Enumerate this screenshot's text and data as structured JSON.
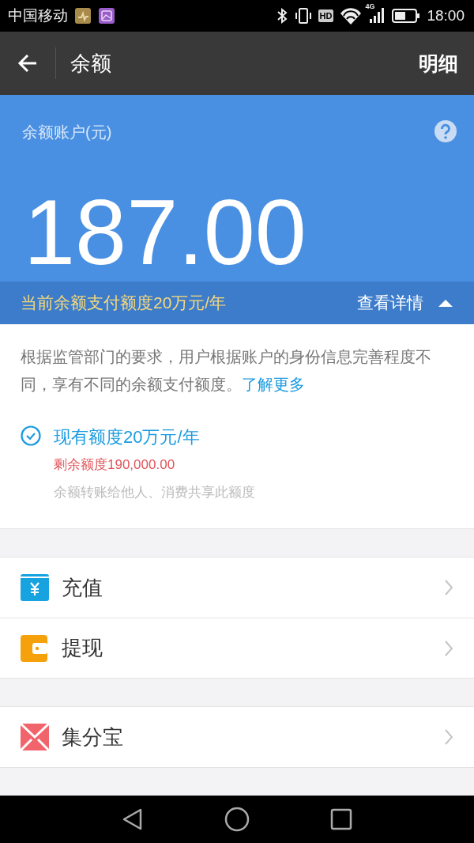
{
  "status_bar": {
    "carrier": "中国移动",
    "hd": "HD",
    "network": "4G",
    "time": "18:00"
  },
  "app_bar": {
    "title": "余额",
    "action": "明细"
  },
  "balance": {
    "label": "余额账户(元)",
    "amount": "187.00"
  },
  "limit_bar": {
    "text": "当前余额支付额度20万元/年",
    "link": "查看详情",
    "expanded": true
  },
  "info": {
    "description": "根据监管部门的要求，用户根据账户的身份信息完善程度不同，享有不同的余额支付额度。",
    "link": "了解更多",
    "tier": {
      "title": "现有额度20万元/年",
      "checked": true,
      "remaining": "剩余额度190,000.00",
      "note": "余额转账给他人、消费共享此额度"
    }
  },
  "menu_groups": [
    [
      {
        "label": "充值",
        "kind": "recharge"
      },
      {
        "label": "提现",
        "kind": "withdraw"
      }
    ],
    [
      {
        "label": "集分宝",
        "kind": "points"
      }
    ]
  ]
}
